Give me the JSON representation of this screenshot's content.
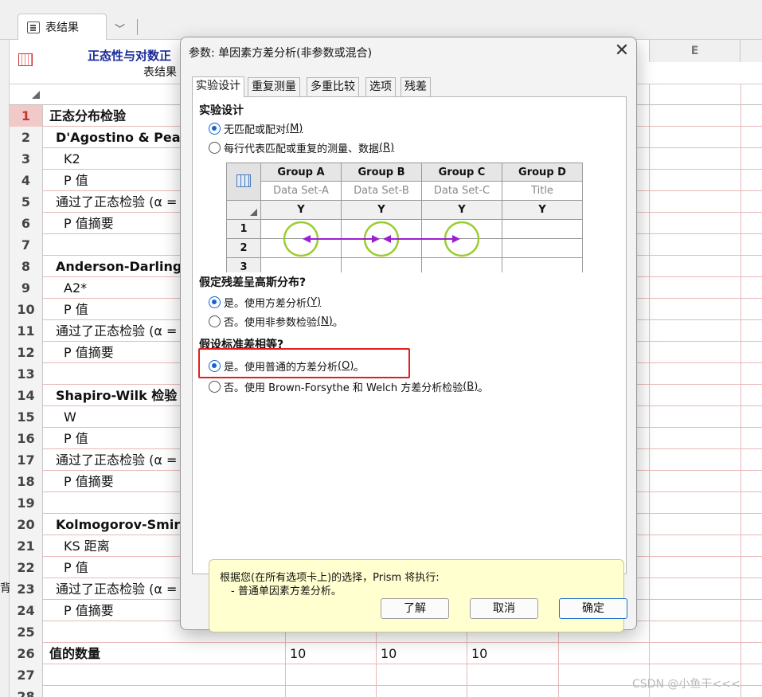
{
  "workbook": {
    "tab_label": "表结果",
    "sheet_title": "正态性与对数正",
    "sheet_subtitle": "表结果",
    "col_e": "E",
    "rows": [
      {
        "n": "1",
        "title": "正态分布检验",
        "bold": true,
        "indent": 0
      },
      {
        "n": "2",
        "title": "D'Agostino & Pear",
        "bold": true,
        "indent": 1
      },
      {
        "n": "3",
        "title": "K2",
        "bold": false,
        "indent": 2
      },
      {
        "n": "4",
        "title": "P 值",
        "bold": false,
        "indent": 2
      },
      {
        "n": "5",
        "title": "通过了正态检验 (α =",
        "bold": false,
        "indent": 1
      },
      {
        "n": "6",
        "title": "P 值摘要",
        "bold": false,
        "indent": 2
      },
      {
        "n": "7",
        "title": "",
        "bold": false,
        "indent": 0
      },
      {
        "n": "8",
        "title": "Anderson-Darling",
        "bold": true,
        "indent": 1
      },
      {
        "n": "9",
        "title": "A2*",
        "bold": false,
        "indent": 2
      },
      {
        "n": "10",
        "title": "P 值",
        "bold": false,
        "indent": 2
      },
      {
        "n": "11",
        "title": "通过了正态检验 (α =",
        "bold": false,
        "indent": 1
      },
      {
        "n": "12",
        "title": "P 值摘要",
        "bold": false,
        "indent": 2
      },
      {
        "n": "13",
        "title": "",
        "bold": false,
        "indent": 0
      },
      {
        "n": "14",
        "title": "Shapiro-Wilk 检验",
        "bold": true,
        "indent": 1
      },
      {
        "n": "15",
        "title": "W",
        "bold": false,
        "indent": 2
      },
      {
        "n": "16",
        "title": "P 值",
        "bold": false,
        "indent": 2
      },
      {
        "n": "17",
        "title": "通过了正态检验 (α =",
        "bold": false,
        "indent": 1
      },
      {
        "n": "18",
        "title": "P 值摘要",
        "bold": false,
        "indent": 2
      },
      {
        "n": "19",
        "title": "",
        "bold": false,
        "indent": 0
      },
      {
        "n": "20",
        "title": "Kolmogorov-Smir",
        "bold": true,
        "indent": 1
      },
      {
        "n": "21",
        "title": "KS 距离",
        "bold": false,
        "indent": 2
      },
      {
        "n": "22",
        "title": "P 值",
        "bold": false,
        "indent": 2
      },
      {
        "n": "23",
        "title": "通过了正态检验 (α =",
        "bold": false,
        "indent": 1
      },
      {
        "n": "24",
        "title": "P 值摘要",
        "bold": false,
        "indent": 2
      },
      {
        "n": "25",
        "title": "",
        "bold": false,
        "indent": 0
      },
      {
        "n": "26",
        "title": "值的数量",
        "bold": true,
        "indent": 0
      },
      {
        "n": "27",
        "title": "",
        "bold": false,
        "indent": 0
      },
      {
        "n": "28",
        "title": "",
        "bold": false,
        "indent": 0
      }
    ],
    "row26_values": [
      "10",
      "10",
      "10"
    ],
    "left_glyph": "背"
  },
  "dialog": {
    "title": "参数: 单因素方差分析(非参数或混合)",
    "close": "✕",
    "tabs": [
      "实验设计",
      "重复测量",
      "多重比较",
      "选项",
      "残差"
    ],
    "section1": {
      "heading": "实验设计",
      "opt1": {
        "text": "无匹配或配对",
        "key": "(M)"
      },
      "opt2": {
        "text": "每行代表匹配或重复的测量、数据",
        "key": "(R)"
      }
    },
    "illustration": {
      "headers": [
        "Group A",
        "Group B",
        "Group C",
        "Group D"
      ],
      "subs": [
        "Data Set-A",
        "Data Set-B",
        "Data Set-C",
        "Title"
      ],
      "y": "Y",
      "row_numbers": [
        "1",
        "2",
        "3"
      ]
    },
    "section2": {
      "heading": "假定残差呈高斯分布?",
      "opt1": {
        "text": "是。使用方差分析",
        "key": "(Y)"
      },
      "opt2": {
        "text": "否。使用非参数检验",
        "key": "(N)",
        "suffix": "。"
      }
    },
    "section3": {
      "heading": "假设标准差相等?",
      "opt1": {
        "text": "是。使用普通的方差分析",
        "key": "(O)",
        "suffix": "。"
      },
      "opt2": {
        "text": "否。使用 Brown-Forsythe 和 Welch 方差分析检验",
        "key": "(B)",
        "suffix": "。"
      }
    },
    "summary": {
      "line1": "根据您(在所有选项卡上)的选择，Prism 将执行:",
      "line2": "- 普通单因素方差分析。"
    },
    "buttons": {
      "learn": "了解",
      "cancel": "取消",
      "ok": "确定"
    }
  },
  "watermark": "CSDN @小鱼干<<<",
  "colors": {
    "accent": "#1464c8",
    "highlight": "#e02020",
    "summary_bg": "#ffffd0",
    "arrow": "#9b1fd0",
    "circle": "#9acd32"
  }
}
